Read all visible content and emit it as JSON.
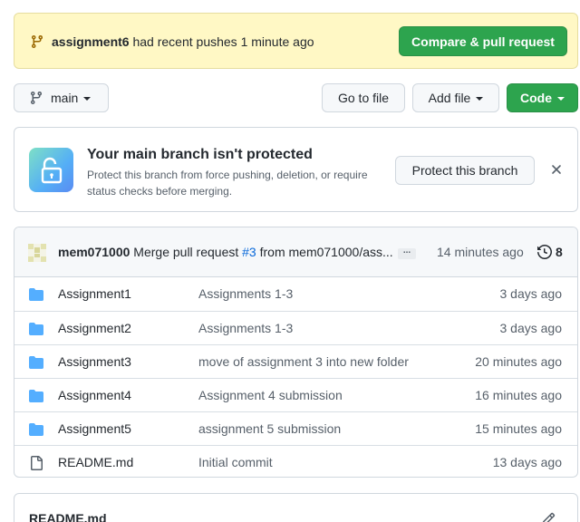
{
  "banner": {
    "branch": "assignment6",
    "message": " had recent pushes 1 minute ago",
    "compare_button": "Compare & pull request"
  },
  "toolbar": {
    "branch_label": "main",
    "goto_file": "Go to file",
    "add_file": "Add file",
    "code": "Code"
  },
  "protect": {
    "title": "Your main branch isn't protected",
    "description": "Protect this branch from force pushing, deletion, or require status checks before merging.",
    "button": "Protect this branch"
  },
  "commit": {
    "author": "mem071000",
    "message_prefix": " Merge pull request ",
    "pr_link": "#3",
    "message_suffix": " from mem071000/ass...",
    "ellipsis": "...",
    "time": "14 minutes ago",
    "history_count": "8"
  },
  "files": [
    {
      "type": "folder",
      "name": "Assignment1",
      "message": "Assignments 1-3",
      "age": "3 days ago"
    },
    {
      "type": "folder",
      "name": "Assignment2",
      "message": "Assignments 1-3",
      "age": "3 days ago"
    },
    {
      "type": "folder",
      "name": "Assignment3",
      "message": "move of assignment 3 into new folder",
      "age": "20 minutes ago"
    },
    {
      "type": "folder",
      "name": "Assignment4",
      "message": "Assignment 4 submission",
      "age": "16 minutes ago"
    },
    {
      "type": "folder",
      "name": "Assignment5",
      "message": "assignment 5 submission",
      "age": "15 minutes ago"
    },
    {
      "type": "file",
      "name": "README.md",
      "message": "Initial commit",
      "age": "13 days ago"
    }
  ],
  "readme": {
    "title": "README.md"
  },
  "colors": {
    "banner_bg": "#fff8c5",
    "primary_green": "#2da44e",
    "folder_blue": "#54aeff",
    "link_blue": "#0969da"
  }
}
